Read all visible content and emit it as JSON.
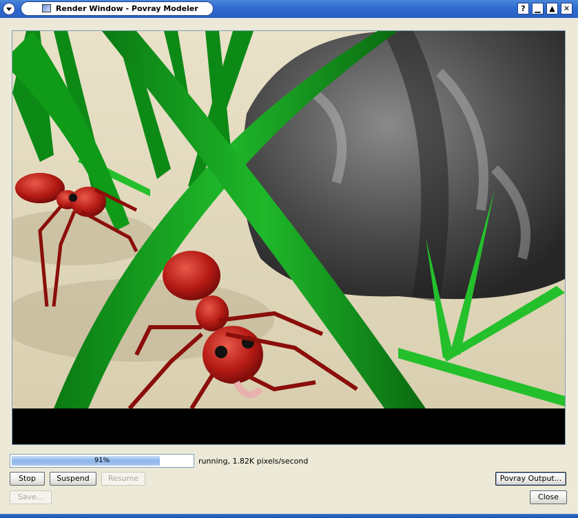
{
  "window": {
    "title": "Render Window - Povray Modeler",
    "buttons": {
      "help": "?",
      "minimize": "▁",
      "maximize": "▲",
      "close": "✕"
    }
  },
  "render": {
    "description_icon": "rendered-scene"
  },
  "progress": {
    "percent": 91,
    "label": "91%",
    "status": "running, 1.82K pixels/second"
  },
  "actions": {
    "stop": "Stop",
    "suspend": "Suspend",
    "resume": "Resume",
    "save": "Save...",
    "povray_output": "Povray Output...",
    "close": "Close"
  },
  "colors": {
    "titlebar": "#2f6bd0",
    "progress_fill": "#8ab4ea",
    "dialog_bg": "#ece9d8"
  }
}
